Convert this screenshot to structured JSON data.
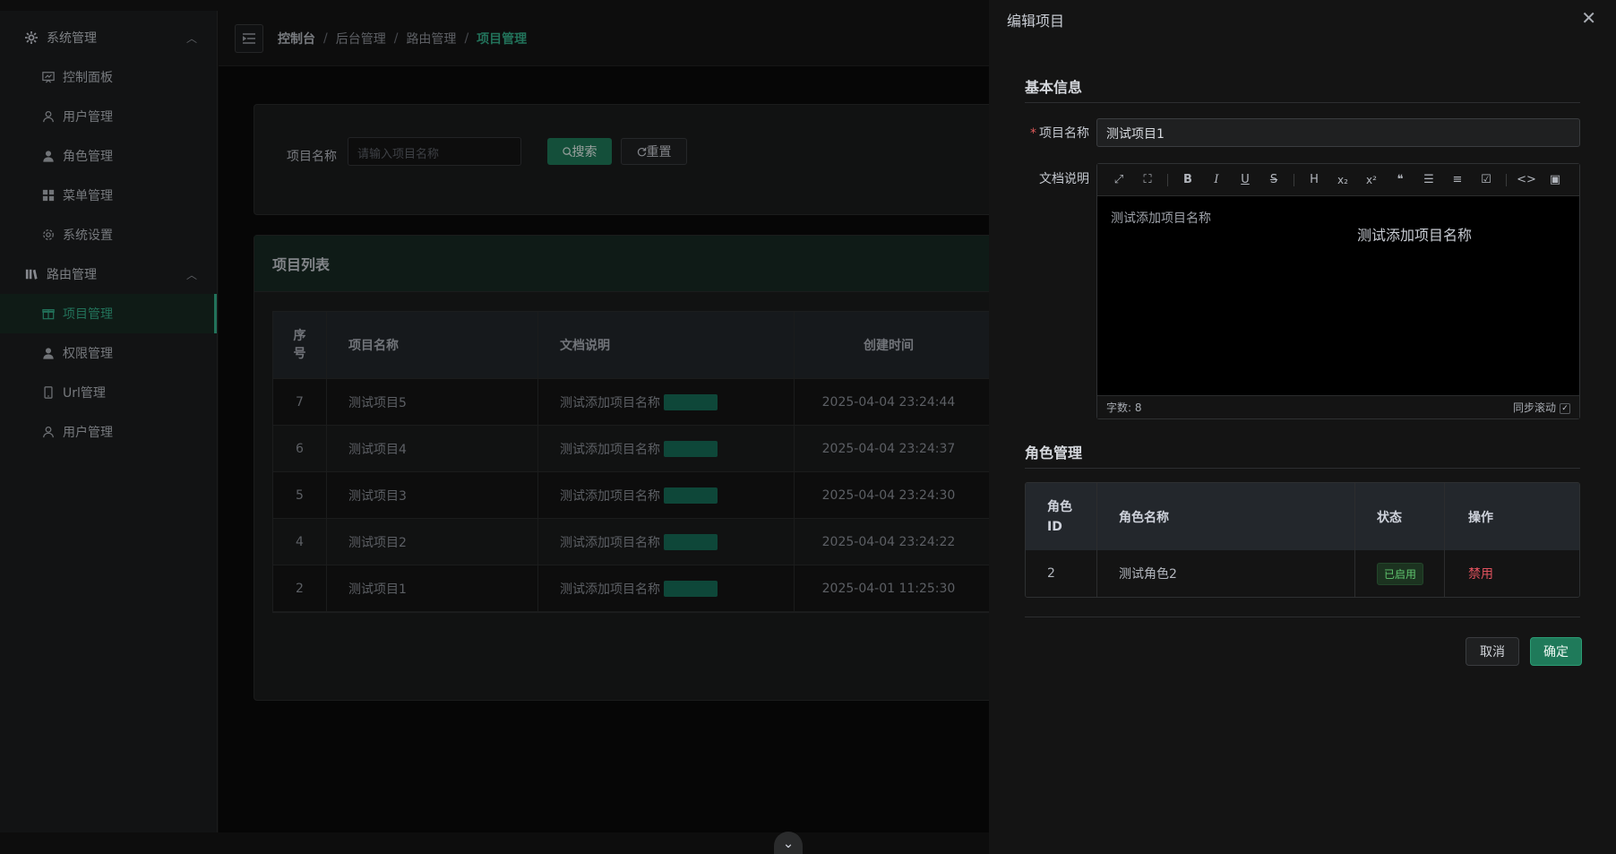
{
  "sidebar": {
    "group1": {
      "label": "系统管理",
      "icon": "gear-icon"
    },
    "group1_items": [
      {
        "label": "控制面板",
        "icon": "dashboard-icon"
      },
      {
        "label": "用户管理",
        "icon": "user-icon"
      },
      {
        "label": "角色管理",
        "icon": "user-solid-icon"
      },
      {
        "label": "菜单管理",
        "icon": "menu-grid-icon"
      },
      {
        "label": "系统设置",
        "icon": "settings-icon"
      }
    ],
    "group2": {
      "label": "路由管理",
      "icon": "library-icon"
    },
    "group2_items": [
      {
        "label": "项目管理",
        "icon": "box-icon",
        "active": true
      },
      {
        "label": "权限管理",
        "icon": "user-solid-icon"
      },
      {
        "label": "Url管理",
        "icon": "phone-icon"
      },
      {
        "label": "用户管理",
        "icon": "user-icon"
      }
    ]
  },
  "breadcrumb": [
    "控制台",
    "后台管理",
    "路由管理",
    "项目管理"
  ],
  "search": {
    "label": "项目名称",
    "placeholder": "请输入项目名称",
    "search_btn": "搜索",
    "reset_btn": "重置"
  },
  "list": {
    "title": "项目列表",
    "columns": [
      "序号",
      "项目名称",
      "文档说明",
      "创建时间"
    ],
    "rows": [
      {
        "no": "7",
        "name": "测试项目5",
        "doc": "测试添加项目名称",
        "time": "2025-04-04 23:24:44"
      },
      {
        "no": "6",
        "name": "测试项目4",
        "doc": "测试添加项目名称",
        "time": "2025-04-04 23:24:37"
      },
      {
        "no": "5",
        "name": "测试项目3",
        "doc": "测试添加项目名称",
        "time": "2025-04-04 23:24:30"
      },
      {
        "no": "4",
        "name": "测试项目2",
        "doc": "测试添加项目名称",
        "time": "2025-04-04 23:24:22"
      },
      {
        "no": "2",
        "name": "测试项目1",
        "doc": "测试添加项目名称",
        "time": "2025-04-01 11:25:30"
      }
    ]
  },
  "drawer": {
    "title": "编辑项目",
    "basic_section": "基本信息",
    "name_label": "项目名称",
    "name_value": "测试项目1",
    "doc_label": "文档说明",
    "editor": {
      "toolbar": [
        "expand-icon",
        "fullscreen-icon",
        "bold-icon",
        "italic-icon",
        "underline-icon",
        "strikethrough-icon",
        "heading-icon",
        "subscript-icon",
        "superscript-icon",
        "quote-icon",
        "bullet-list-icon",
        "ordered-list-icon",
        "task-list-icon",
        "code-icon",
        "preview-icon"
      ],
      "source_text": "测试添加项目名称",
      "preview_text": "测试添加项目名称",
      "word_count": "字数: 8",
      "sync_scroll": "同步滚动"
    },
    "role_section": "角色管理",
    "role_columns": [
      "角色ID",
      "角色名称",
      "状态",
      "操作"
    ],
    "role_rows": [
      {
        "id": "2",
        "name": "测试角色2",
        "status": "已启用",
        "action": "禁用"
      }
    ],
    "cancel": "取消",
    "confirm": "确定"
  },
  "colors": {
    "accent": "#35b08a",
    "primary_btn": "#1f7a5a",
    "danger": "#e0525e",
    "success": "#5fc46e"
  }
}
